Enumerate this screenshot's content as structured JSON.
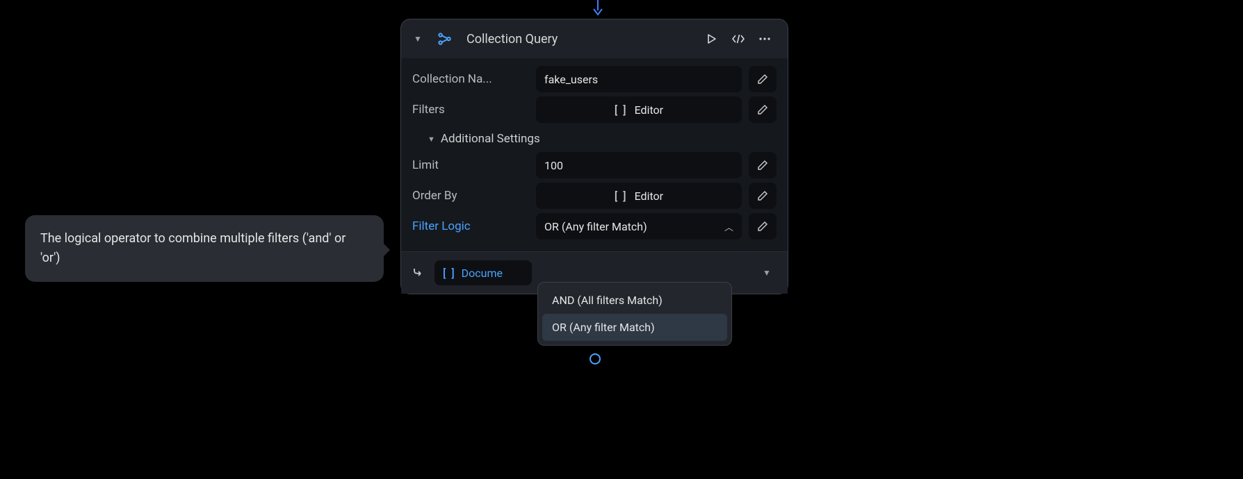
{
  "header": {
    "title": "Collection Query"
  },
  "fields": {
    "collection_name": {
      "label": "Collection Na...",
      "value": "fake_users"
    },
    "filters": {
      "label": "Filters",
      "value": "Editor"
    },
    "additional_settings_label": "Additional Settings",
    "limit": {
      "label": "Limit",
      "value": "100"
    },
    "order_by": {
      "label": "Order By",
      "value": "Editor"
    },
    "filter_logic": {
      "label": "Filter Logic",
      "value": "OR (Any filter Match)"
    }
  },
  "filter_logic_options": [
    "AND (All filters Match)",
    "OR (Any filter Match)"
  ],
  "output": {
    "label": "Docume"
  },
  "tooltip": "The logical operator to combine multiple filters ('and' or 'or')"
}
